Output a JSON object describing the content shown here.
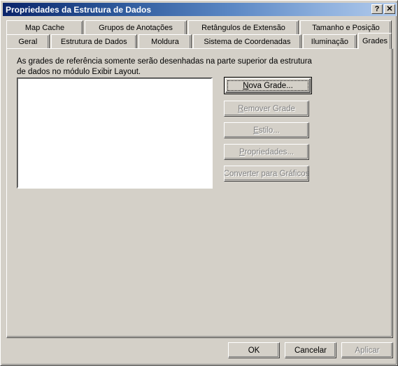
{
  "window": {
    "title": "Propriedades da Estrutura de Dados",
    "help_button": "?",
    "close_button": "✕"
  },
  "tabs": {
    "row1": [
      {
        "label": "Map Cache",
        "active": false,
        "width": 110
      },
      {
        "label": "Grupos de Anotações",
        "active": false,
        "width": 146
      },
      {
        "label": "Retângulos de Extensão",
        "active": false,
        "width": 158
      },
      {
        "label": "Tamanho e Posição",
        "active": false,
        "width": 131
      }
    ],
    "row2": [
      {
        "label": "Geral",
        "active": false,
        "width": 63
      },
      {
        "label": "Estrutura de Dados",
        "active": false,
        "width": 126
      },
      {
        "label": "Moldura",
        "active": false,
        "width": 78
      },
      {
        "label": "Sistema de Coordenadas",
        "active": false,
        "width": 158
      },
      {
        "label": "Iluminação",
        "active": false,
        "width": 79
      },
      {
        "label": "Grades",
        "active": true,
        "width": 49
      }
    ]
  },
  "panel": {
    "description": "As grades de referência somente serão desenhadas na parte superior da estrutura de dados no módulo Exibir Layout.",
    "grid_list": {
      "items": [],
      "empty": true
    },
    "buttons": [
      {
        "label": "Nova Grade...",
        "accel": "N",
        "enabled": true,
        "default": true
      },
      {
        "label": "Remover Grade",
        "accel": "R",
        "enabled": false,
        "default": false
      },
      {
        "label": "Estilo...",
        "accel": "E",
        "enabled": false,
        "default": false
      },
      {
        "label": "Propriedades...",
        "accel": "P",
        "enabled": false,
        "default": false
      },
      {
        "label": "Converter para Gráficos",
        "accel": "",
        "enabled": false,
        "default": false
      }
    ]
  },
  "footer": {
    "ok": "OK",
    "cancel": "Cancelar",
    "apply": "Aplicar",
    "apply_enabled": false
  },
  "colors": {
    "dialog_face": "#d4d0c8",
    "title_start": "#0a246a",
    "title_end": "#b2cbec",
    "text": "#000000",
    "disabled_text": "#808080",
    "list_background": "#ffffff"
  }
}
